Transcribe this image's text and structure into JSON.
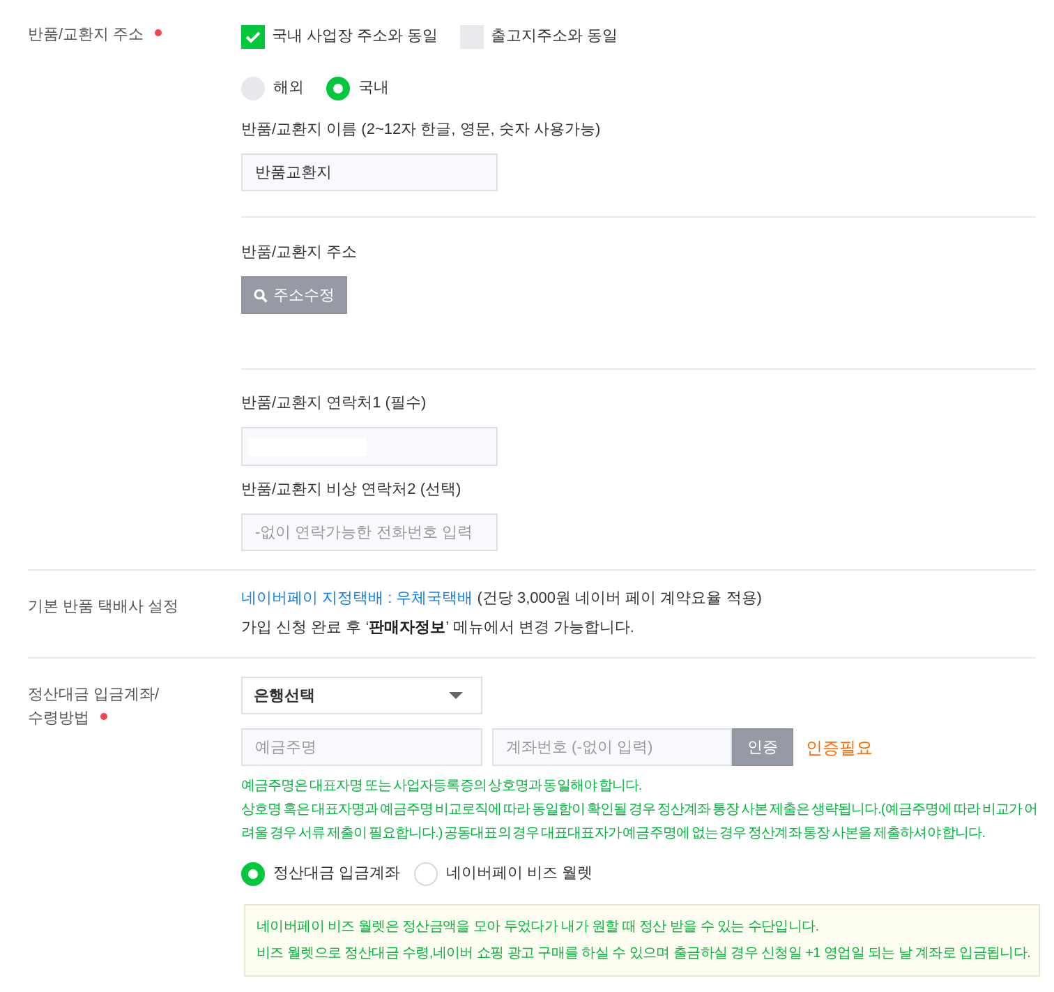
{
  "return_address": {
    "label": "반품/교환지 주소",
    "required": true,
    "checkboxes": [
      {
        "label": "국내 사업장 주소와 동일",
        "checked": true,
        "disabled": false
      },
      {
        "label": "출고지주소와 동일",
        "checked": false,
        "disabled": true
      }
    ],
    "region_radios": [
      {
        "label": "해외",
        "selected": false,
        "disabled": true
      },
      {
        "label": "국내",
        "selected": true,
        "disabled": false
      }
    ],
    "name_field": {
      "label": "반품/교환지 이름 (2~12자 한글, 영문, 숫자 사용가능)",
      "value": "반품교환지"
    },
    "address": {
      "label": "반품/교환지 주소",
      "button": {
        "label": "주소수정",
        "disabled": true
      }
    },
    "contact_fields": [
      {
        "label": "반품/교환지 연락처1 (필수)",
        "value_hidden": true
      },
      {
        "label": "반품/교환지 비상 연락처2 (선택)",
        "placeholder": "-없이 연락가능한 전화번호 입력",
        "value_hidden": false
      }
    ]
  },
  "courier": {
    "label": "기본 반품 택배사 설정",
    "carrier_link": "네이버페이 지정택배 : 우체국택배",
    "carrier_note": "(건당 3,000원 네이버 페이 계약요율 적용)",
    "change_note": "가입 신청 완료 후 ‘**판매자정보**’ 메뉴에서 변경 가능합니다."
  },
  "settlement": {
    "label": "정산대금 입금계좌/\n수령방법",
    "required": true,
    "bank_select": {
      "value": "은행선택"
    },
    "holder_field": {
      "placeholder": "예금주명"
    },
    "account_field": {
      "placeholder": "계좌번호 (-없이 입력)"
    },
    "verify_button": {
      "label": "인증",
      "disabled": true
    },
    "verify_status": {
      "text": "인증필요",
      "verified": false
    },
    "notes": [
      "예금주명은 대표자명 또는 사업자등록증의 상호명과 동일해야 합니다.",
      "상호명 혹은 대표자명과 예금주명 비교로직에 따라 동일함이 확인될 경우 정산계좌 통장 사본 제출은 생략됩니다.(예금주명에 따라 비교가 어려울 경우 서류 제출이 필요합니다.) 공동대표의 경우 대표대표자가 예금주명에 없는 경우 정산계좌 통장 사본을 제출하셔야 합니다."
    ],
    "method_radios": [
      {
        "label": "정산대금 입금계좌",
        "selected": true,
        "disabled": false
      },
      {
        "label": "네이버페이 비즈 월렛",
        "selected": false,
        "disabled": false
      }
    ],
    "info_lines": [
      "네이버페이 비즈 월렛은 정산금액을 모아 두었다가 내가 원할 때 정산 받을 수 있는 수단입니다.",
      "비즈 월렛으로 정산대금 수령,네이버 쇼핑 광고 구매를 하실 수 있으며 출금하실 경우 신청일 +1 영업일 되는 날 계좌로 입금됩니다."
    ]
  }
}
